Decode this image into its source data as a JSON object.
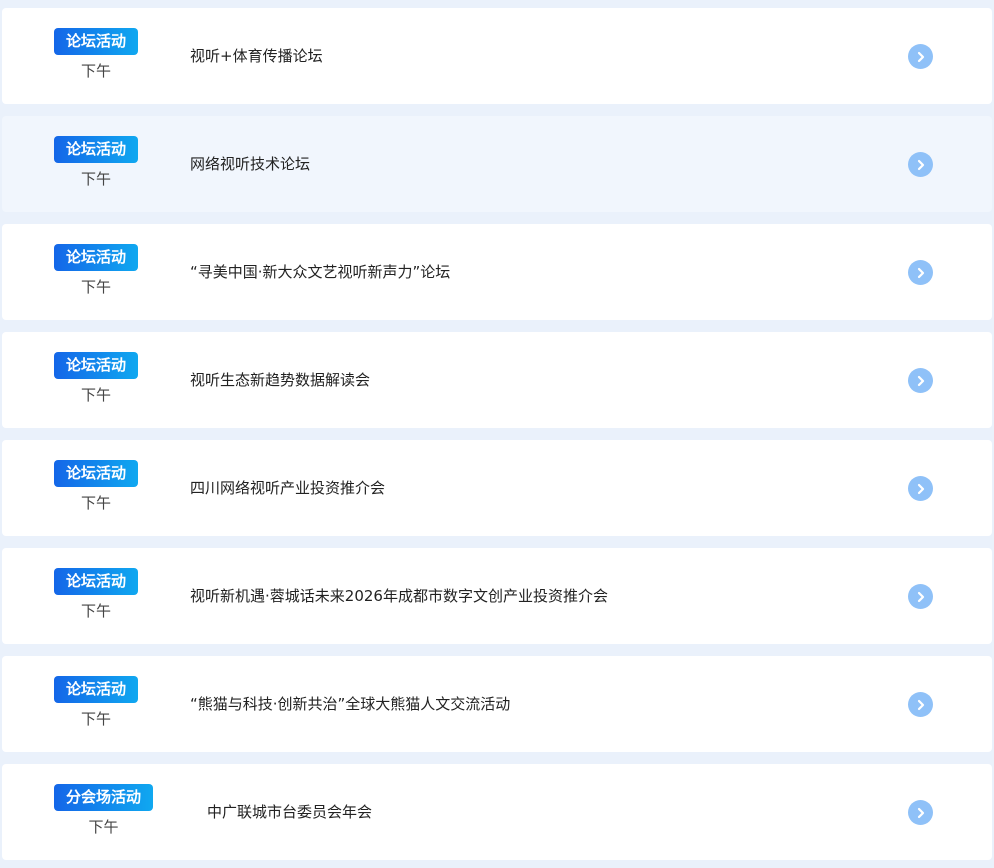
{
  "events": [
    {
      "tag": "论坛活动",
      "time": "下午",
      "title": "视听+体育传播论坛"
    },
    {
      "tag": "论坛活动",
      "time": "下午",
      "title": "网络视听技术论坛"
    },
    {
      "tag": "论坛活动",
      "time": "下午",
      "title": "“寻美中国·新大众文艺视听新声力”论坛"
    },
    {
      "tag": "论坛活动",
      "time": "下午",
      "title": "视听生态新趋势数据解读会"
    },
    {
      "tag": "论坛活动",
      "time": "下午",
      "title": "四川网络视听产业投资推介会"
    },
    {
      "tag": "论坛活动",
      "time": "下午",
      "title": "视听新机遇·蓉城话未来2026年成都市数字文创产业投资推介会"
    },
    {
      "tag": "论坛活动",
      "time": "下午",
      "title": "“熊猫与科技·创新共治”全球大熊猫人文交流活动"
    },
    {
      "tag": "分会场活动",
      "time": "下午",
      "title": "中广联城市台委员会年会"
    }
  ],
  "icons": {
    "arrow": "chevron-right-circle-icon"
  },
  "colors": {
    "tag_start": "#1466e8",
    "tag_end": "#10a8f0",
    "arrow": "#8fc1f8",
    "page_bg": "#eaf1fb",
    "highlight_row": "#f1f6fd"
  }
}
